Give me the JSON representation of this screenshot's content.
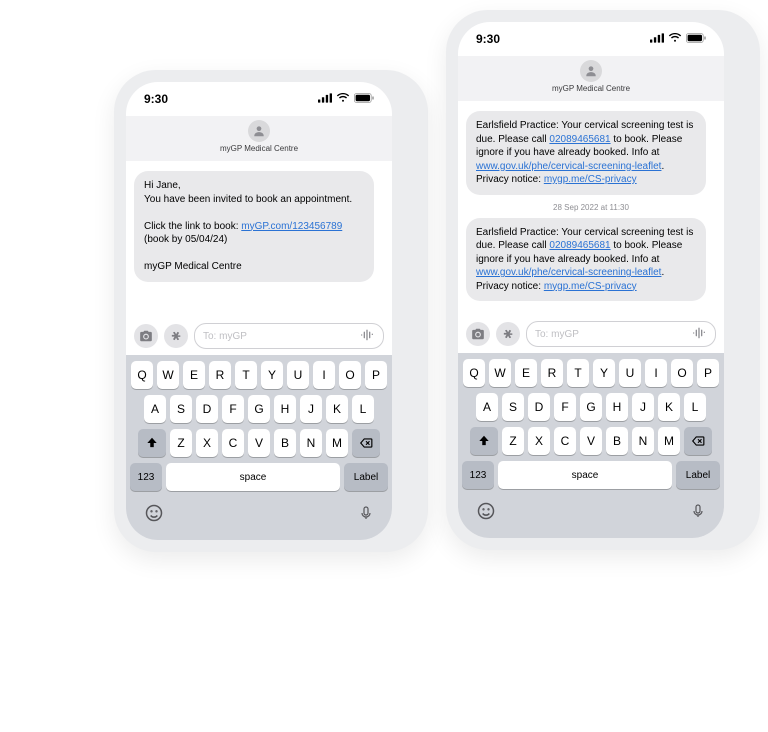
{
  "status": {
    "time": "9:30"
  },
  "phones": [
    {
      "header": "myGP Medical Centre",
      "compose_placeholder": "To: myGP",
      "messages": [
        {
          "parts": [
            {
              "t": "text",
              "v": "Hi Jane,"
            },
            {
              "t": "br"
            },
            {
              "t": "text",
              "v": "You have been invited to book an appointment."
            },
            {
              "t": "br"
            },
            {
              "t": "br"
            },
            {
              "t": "text",
              "v": "Click the link to book: "
            },
            {
              "t": "link",
              "v": "myGP.com/123456789"
            },
            {
              "t": "text",
              "v": " (book by 05/04/24)"
            },
            {
              "t": "br"
            },
            {
              "t": "br"
            },
            {
              "t": "text",
              "v": "myGP Medical Centre"
            }
          ]
        }
      ],
      "timestamps": []
    },
    {
      "header": "myGP Medical Centre",
      "compose_placeholder": "To: myGP",
      "messages": [
        {
          "parts": [
            {
              "t": "text",
              "v": "Earlsfield Practice: Your cervical screening test is due. Please call "
            },
            {
              "t": "link",
              "v": "02089465681"
            },
            {
              "t": "text",
              "v": " to book. Please ignore if you have already booked. Info at "
            },
            {
              "t": "link",
              "v": "www.gov.uk/phe/cervical-screening-leaflet"
            },
            {
              "t": "text",
              "v": ". Privacy notice: "
            },
            {
              "t": "link",
              "v": "mygp.me/CS-privacy"
            }
          ]
        },
        {
          "parts": [
            {
              "t": "text",
              "v": "Earlsfield Practice: Your cervical screening test is due. Please call "
            },
            {
              "t": "link",
              "v": "02089465681"
            },
            {
              "t": "text",
              "v": " to book. Please ignore if you have already booked. Info at "
            },
            {
              "t": "link",
              "v": "www.gov.uk/phe/cervical-screening-leaflet"
            },
            {
              "t": "text",
              "v": ". Privacy notice: "
            },
            {
              "t": "link",
              "v": "mygp.me/CS-privacy"
            }
          ]
        }
      ],
      "timestamps": [
        "28 Sep 2022 at 11:30"
      ]
    }
  ],
  "keyboard": {
    "row1": [
      "Q",
      "W",
      "E",
      "R",
      "T",
      "Y",
      "U",
      "I",
      "O",
      "P"
    ],
    "row2": [
      "A",
      "S",
      "D",
      "F",
      "G",
      "H",
      "J",
      "K",
      "L"
    ],
    "row3": [
      "Z",
      "X",
      "C",
      "V",
      "B",
      "N",
      "M"
    ],
    "num": "123",
    "space": "space",
    "label": "Label"
  }
}
